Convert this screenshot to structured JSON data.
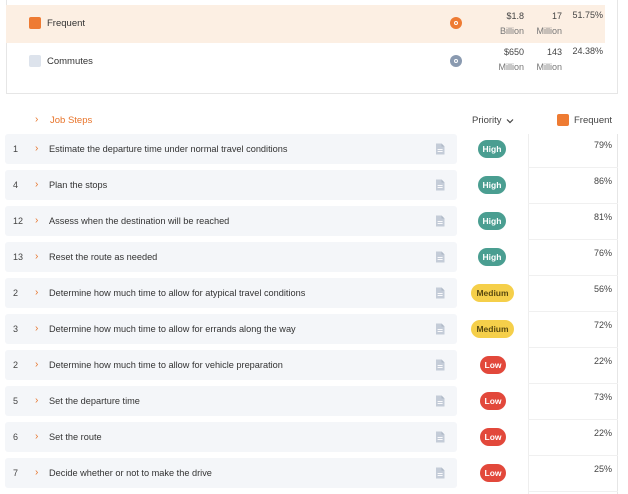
{
  "colors": {
    "accent": "#e8742a",
    "high": "#4a9e91",
    "medium": "#f5cf4a",
    "low": "#e2483b"
  },
  "segments": [
    {
      "name": "Frequent",
      "swatch": "#ee7b33",
      "icon_color": "#ee7b33",
      "icon": "target-icon",
      "revenue": "$1.8",
      "revenue_unit": "Billion",
      "count": "17",
      "count_unit": "Million",
      "share": "51.75%"
    },
    {
      "name": "Commutes",
      "swatch": "#dde3ec",
      "icon_color": "#8a9ab0",
      "icon": "target-icon",
      "revenue": "$650",
      "revenue_unit": "Million",
      "count": "143",
      "count_unit": "Million",
      "share": "24.38%"
    }
  ],
  "header": {
    "section_label": "Job Steps",
    "priority_label": "Priority",
    "segment_label": "Frequent",
    "segment_swatch": "#ee7b33"
  },
  "steps": [
    {
      "num": "1",
      "text": "Estimate the departure time under normal travel conditions",
      "priority": "High",
      "level": "high",
      "pct": "79%"
    },
    {
      "num": "4",
      "text": "Plan the stops",
      "priority": "High",
      "level": "high",
      "pct": "86%"
    },
    {
      "num": "12",
      "text": "Assess when the destination will be reached",
      "priority": "High",
      "level": "high",
      "pct": "81%"
    },
    {
      "num": "13",
      "text": "Reset the route as needed",
      "priority": "High",
      "level": "high",
      "pct": "76%"
    },
    {
      "num": "2",
      "text": "Determine how much time to allow for atypical travel conditions",
      "priority": "Medium",
      "level": "medium",
      "pct": "56%"
    },
    {
      "num": "3",
      "text": "Determine how much time to allow for errands along the way",
      "priority": "Medium",
      "level": "medium",
      "pct": "72%"
    },
    {
      "num": "2",
      "text": "Determine how much time to allow for vehicle preparation",
      "priority": "Low",
      "level": "low",
      "pct": "22%"
    },
    {
      "num": "5",
      "text": "Set the departure time",
      "priority": "Low",
      "level": "low",
      "pct": "73%"
    },
    {
      "num": "6",
      "text": "Set the route",
      "priority": "Low",
      "level": "low",
      "pct": "22%"
    },
    {
      "num": "7",
      "text": "Decide whether or not to make the drive",
      "priority": "Low",
      "level": "low",
      "pct": "25%"
    }
  ]
}
